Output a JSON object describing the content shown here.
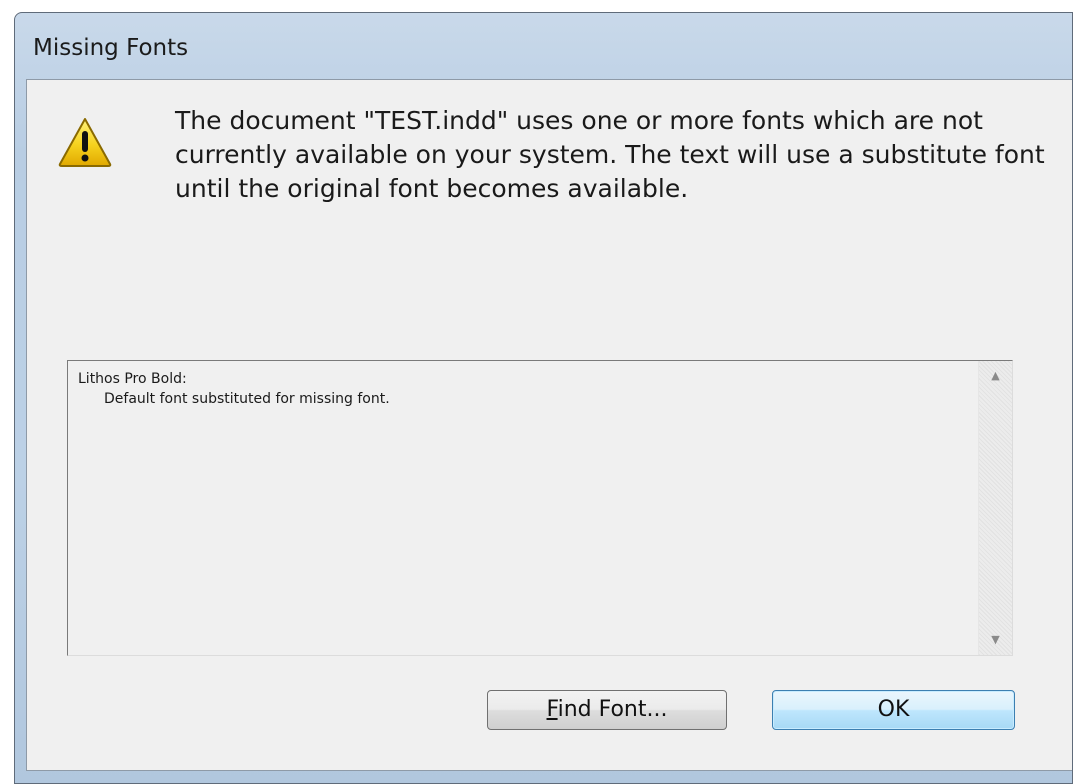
{
  "window": {
    "title": "Missing Fonts"
  },
  "message": "The document \"TEST.indd\" uses one or more fonts which are not currently available on your system. The text will use a substitute font until the original font becomes available.",
  "icon": "warning-icon",
  "font_list": {
    "items": [
      {
        "font_name": "Lithos Pro Bold:",
        "detail": "Default font substituted for missing font."
      }
    ]
  },
  "buttons": {
    "find_font": {
      "mnemonic": "F",
      "rest": "ind Font..."
    },
    "ok": "OK"
  },
  "colors": {
    "ok_border": "#3c7fb1",
    "warning_yellow": "#f6d21e"
  }
}
